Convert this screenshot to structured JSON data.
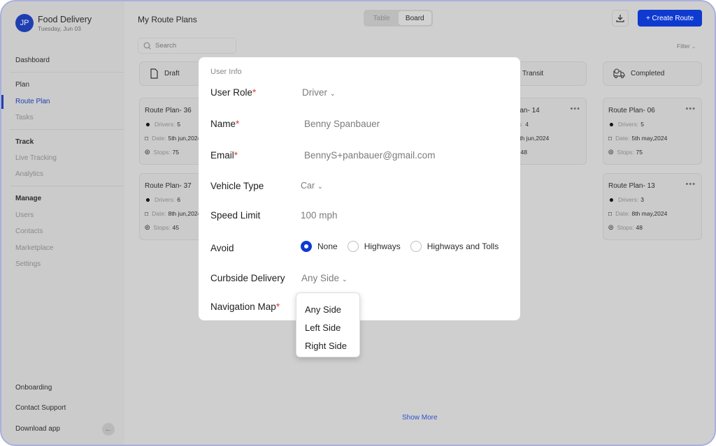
{
  "app": {
    "avatar_initials": "JP",
    "title": "Food Delivery",
    "date": "Tuesday, Jun 03"
  },
  "sidebar": {
    "dashboard": "Dashboard",
    "sections": [
      {
        "heading": "Plan",
        "items": [
          "Route Plan",
          "Tasks"
        ]
      },
      {
        "heading": "Track",
        "items": [
          "Live Tracking",
          "Analytics"
        ]
      },
      {
        "heading": "Manage",
        "items": [
          "Users",
          "Contacts",
          "Marketplace",
          "Settings"
        ]
      }
    ],
    "active_item": "Route Plan",
    "footer": [
      "Onboarding",
      "Contact Support",
      "Download app"
    ],
    "collapse_icon": "arrow-left-icon"
  },
  "header": {
    "title": "My Route Plans",
    "view_toggle": [
      "Table",
      "Board"
    ],
    "active_view": "Board",
    "download_icon": "download-icon",
    "create_button": "+ Create Route"
  },
  "search": {
    "placeholder": "Search"
  },
  "filter": {
    "label": "Filter"
  },
  "columns": [
    {
      "label": "Draft",
      "icon": "document-icon"
    },
    {
      "label": "Transit",
      "icon": "truck-icon"
    },
    {
      "label": "Completed",
      "icon": "truck-check-icon"
    }
  ],
  "cards": {
    "draft": [
      {
        "title": "Route Plan- 36",
        "drivers": "5",
        "date": "5th jun,2024",
        "stops": "75"
      },
      {
        "title": "Route Plan- 37",
        "drivers": "6",
        "date": "8th jun,2024",
        "stops": "45"
      }
    ],
    "transit": [
      {
        "title": "Route Plan- 14",
        "drivers": "4",
        "date": "9th jun,2024",
        "stops": "48"
      }
    ],
    "completed": [
      {
        "title": "Route Plan- 06",
        "drivers": "5",
        "date": "5th may,2024",
        "stops": "75"
      },
      {
        "title": "Route Plan- 13",
        "drivers": "3",
        "date": "8th may,2024",
        "stops": "48"
      }
    ],
    "labels": {
      "drivers": "Drivers:",
      "date": "Date:",
      "stops": "Stops:"
    }
  },
  "show_more": "Show More",
  "modal": {
    "section": "User Info",
    "fields": {
      "user_role": {
        "label": "User Role",
        "required": "*",
        "value": "Driver"
      },
      "name": {
        "label": "Name",
        "required": "*",
        "value": "Benny Spanbauer"
      },
      "email": {
        "label": "Email",
        "required": "*",
        "value": "BennyS+panbauer@gmail.com"
      },
      "vehicle_type": {
        "label": "Vehicle Type",
        "value": "Car"
      },
      "speed_limit": {
        "label": "Speed Limit",
        "value": "100 mph"
      },
      "avoid": {
        "label": "Avoid",
        "options": [
          "None",
          "Highways",
          "Highways and Tolls"
        ],
        "selected": "None"
      },
      "curbside": {
        "label": "Curbside Delivery",
        "value": "Any Side"
      },
      "nav_map": {
        "label": "Navigation Map",
        "required": "*"
      }
    },
    "dropdown_options": [
      "Any Side",
      "Left Side",
      "Right Side"
    ]
  },
  "colors": {
    "accent": "#0f3ad0",
    "required": "#d83b3b",
    "link": "#2f54c8"
  }
}
